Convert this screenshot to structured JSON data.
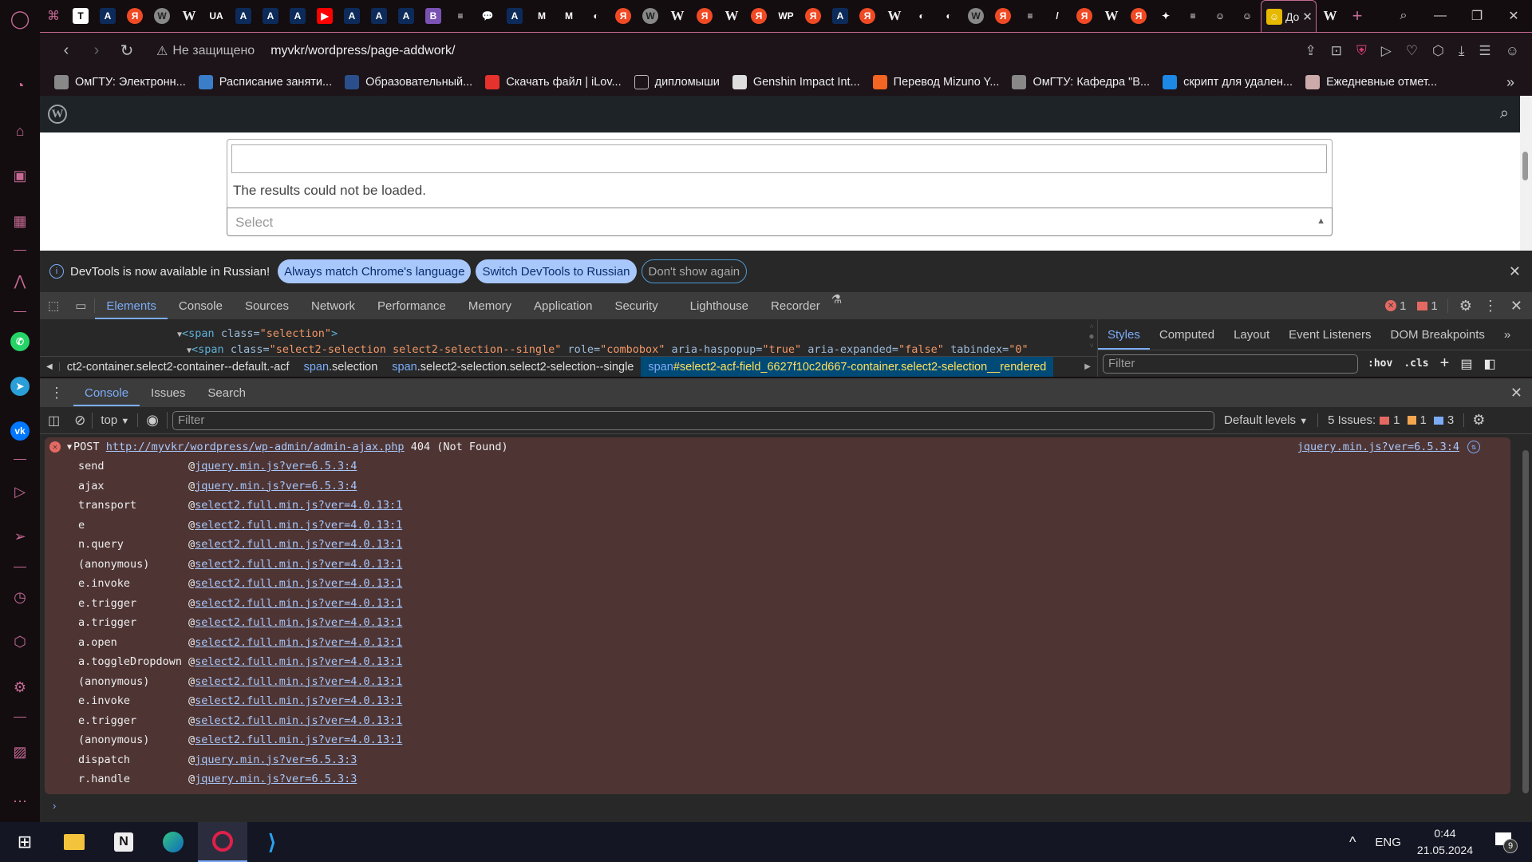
{
  "browser": {
    "active_tab_title": "Дo",
    "favicons": [
      "T",
      "A",
      "Я",
      "W",
      "W",
      "UA",
      "A",
      "A",
      "A",
      "▶",
      "A",
      "A",
      "A",
      "B",
      "≡",
      "💬",
      "A",
      "M",
      "M",
      "◐",
      "Я",
      "W",
      "W",
      "Я",
      "W",
      "Я",
      "WP",
      "Я",
      "A",
      "Я",
      "W",
      "◐",
      "◐",
      "W",
      "Я",
      "≡",
      "/",
      "Я",
      "W",
      "Я",
      "✦",
      "≡",
      "☺",
      "☺"
    ],
    "new_tab_label": "+",
    "security_label": "Не защищено",
    "url": "myvkr/wordpress/page-addwork/",
    "bookmarks": [
      {
        "label": "ОмГТУ: Электронн...",
        "color": "#888"
      },
      {
        "label": "Расписание заняти...",
        "color": "#3a7dc9"
      },
      {
        "label": "Образовательный...",
        "color": "#2b4f8c"
      },
      {
        "label": "Скачать файл | iLov...",
        "color": "#e5322d"
      },
      {
        "label": "дипломыши",
        "color": "transparent"
      },
      {
        "label": "Genshin Impact Int...",
        "color": "#ddd"
      },
      {
        "label": "Перевод Mizuno Y...",
        "color": "#f26522"
      },
      {
        "label": "ОмГТУ: Кафедра \"В...",
        "color": "#888"
      },
      {
        "label": "скрипт для удален...",
        "color": "#1e88e5"
      },
      {
        "label": "Ежедневные отмет...",
        "color": "#caa"
      }
    ],
    "bookmarks_more": "»"
  },
  "page": {
    "search_input_value": "",
    "results_message": "The results could not be loaded.",
    "select_placeholder": "Select"
  },
  "devtools": {
    "banner": {
      "message": "DevTools is now available in Russian!",
      "btn_match": "Always match Chrome's language",
      "btn_switch": "Switch DevTools to Russian",
      "btn_dont_show": "Don't show again"
    },
    "tabs": [
      "Elements",
      "Console",
      "Sources",
      "Network",
      "Performance",
      "Memory",
      "Application",
      "Security",
      "Lighthouse",
      "Recorder"
    ],
    "active_tab": "Elements",
    "error_count": "1",
    "issue_count": "1",
    "elements": {
      "line1_tag_open": "<span ",
      "line1_attr": "class=",
      "line1_val": "\"selection\"",
      "line1_close": ">",
      "line2": [
        {
          "t": "tag",
          "v": "<span "
        },
        {
          "t": "attr",
          "v": "class="
        },
        {
          "t": "val",
          "v": "\"select2-selection select2-selection--single\""
        },
        {
          "t": "attr",
          "v": " role="
        },
        {
          "t": "val",
          "v": "\"combobox\""
        },
        {
          "t": "attr",
          "v": " aria-haspopup="
        },
        {
          "t": "val",
          "v": "\"true\""
        },
        {
          "t": "attr",
          "v": " aria-expanded="
        },
        {
          "t": "val",
          "v": "\"false\""
        },
        {
          "t": "attr",
          "v": " tabindex="
        },
        {
          "t": "val",
          "v": "\"0\""
        }
      ]
    },
    "breadcrumb": [
      {
        "k": "",
        "v": "ct2-container.select2-container--default.-acf"
      },
      {
        "k": "span",
        ".v": "",
        "v": ".selection"
      },
      {
        "k": "span",
        "v": ".select2-selection.select2-selection--single"
      },
      {
        "k": "span",
        "v": "#select2-acf-field_6627f10c2d667-container.select2-selection__rendered"
      }
    ],
    "styles_tabs": [
      "Styles",
      "Computed",
      "Layout",
      "Event Listeners",
      "DOM Breakpoints"
    ],
    "styles_more": "»",
    "styles_filter_placeholder": "Filter",
    "hov_label": ":hov",
    "cls_label": ".cls",
    "drawer_tabs": [
      "Console",
      "Issues",
      "Search"
    ],
    "console": {
      "context": "top",
      "filter_placeholder": "Filter",
      "levels": "Default levels",
      "issues_label": "5 Issues:",
      "issues_error": "1",
      "issues_warning": "1",
      "issues_info": "3",
      "error": {
        "method": "POST",
        "url": "http://myvkr/wordpress/wp-admin/admin-ajax.php",
        "status": "404 (Not Found)",
        "source": "jquery.min.js?ver=6.5.3:4",
        "stack": [
          {
            "fn": "send",
            "src": "jquery.min.js?ver=6.5.3:4"
          },
          {
            "fn": "ajax",
            "src": "jquery.min.js?ver=6.5.3:4"
          },
          {
            "fn": "transport",
            "src": "select2.full.min.js?ver=4.0.13:1"
          },
          {
            "fn": "e",
            "src": "select2.full.min.js?ver=4.0.13:1"
          },
          {
            "fn": "n.query",
            "src": "select2.full.min.js?ver=4.0.13:1"
          },
          {
            "fn": "(anonymous)",
            "src": "select2.full.min.js?ver=4.0.13:1"
          },
          {
            "fn": "e.invoke",
            "src": "select2.full.min.js?ver=4.0.13:1"
          },
          {
            "fn": "e.trigger",
            "src": "select2.full.min.js?ver=4.0.13:1"
          },
          {
            "fn": "a.trigger",
            "src": "select2.full.min.js?ver=4.0.13:1"
          },
          {
            "fn": "a.open",
            "src": "select2.full.min.js?ver=4.0.13:1"
          },
          {
            "fn": "a.toggleDropdown",
            "src": "select2.full.min.js?ver=4.0.13:1"
          },
          {
            "fn": "(anonymous)",
            "src": "select2.full.min.js?ver=4.0.13:1"
          },
          {
            "fn": "e.invoke",
            "src": "select2.full.min.js?ver=4.0.13:1"
          },
          {
            "fn": "e.trigger",
            "src": "select2.full.min.js?ver=4.0.13:1"
          },
          {
            "fn": "(anonymous)",
            "src": "select2.full.min.js?ver=4.0.13:1"
          },
          {
            "fn": "dispatch",
            "src": "jquery.min.js?ver=6.5.3:3"
          },
          {
            "fn": "r.handle",
            "src": "jquery.min.js?ver=6.5.3:3"
          }
        ]
      }
    }
  },
  "taskbar": {
    "language": "ENG",
    "time": "0:44",
    "date": "21.05.2024",
    "notifications": "9"
  }
}
